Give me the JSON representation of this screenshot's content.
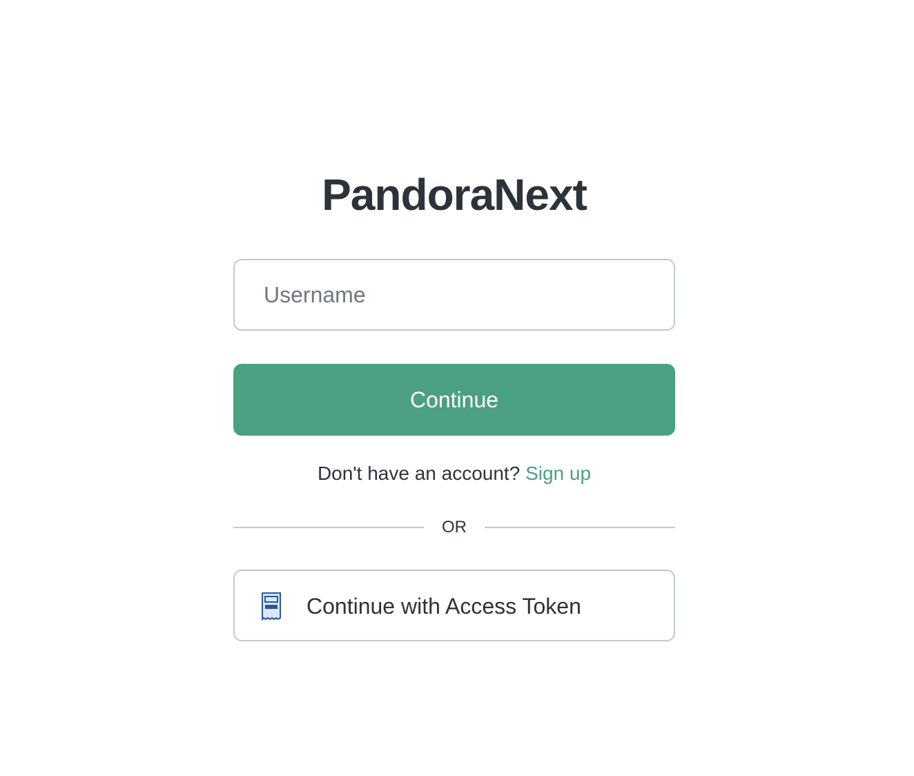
{
  "app": {
    "title": "PandoraNext"
  },
  "login": {
    "username_placeholder": "Username",
    "username_value": "",
    "continue_label": "Continue",
    "no_account_text": "Don't have an account?",
    "signup_label": "Sign up",
    "divider_text": "OR",
    "token_button_label": "Continue with Access Token",
    "token_icon": "receipt-icon"
  },
  "colors": {
    "accent": "#4ba081",
    "text": "#2d333a",
    "border": "#c2c8d0",
    "icon_blue": "#2c5697",
    "icon_fill": "#d9e8f7"
  }
}
